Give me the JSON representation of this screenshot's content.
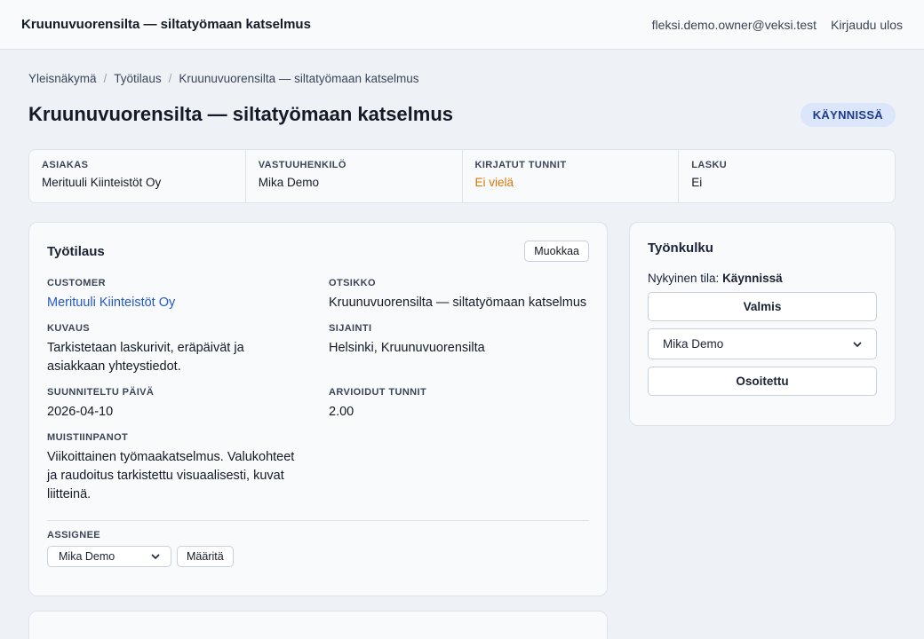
{
  "header": {
    "app_title": "Kruunuvuorensilta — siltatyömaan katselmus",
    "user_email": "fleksi.demo.owner@veksi.test",
    "logout_label": "Kirjaudu ulos"
  },
  "breadcrumb": {
    "items": [
      "Yleisnäkymä",
      "Työtilaus",
      "Kruunuvuorensilta — siltatyömaan katselmus"
    ],
    "separator": "/"
  },
  "page": {
    "title": "Kruunuvuorensilta — siltatyömaan katselmus",
    "status": "KÄYNNISSÄ"
  },
  "summary": [
    {
      "label": "ASIAKAS",
      "value": "Merituuli Kiinteistöt Oy"
    },
    {
      "label": "VASTUUHENKILÖ",
      "value": "Mika Demo"
    },
    {
      "label": "KIRJATUT TUNNIT",
      "value": "Ei vielä"
    },
    {
      "label": "LASKU",
      "value": "Ei"
    }
  ],
  "work_order": {
    "title": "Työtilaus",
    "edit_label": "Muokkaa",
    "customer_label": "CUSTOMER",
    "customer_value": "Merituuli Kiinteistöt Oy",
    "otsikko_label": "OTSIKKO",
    "otsikko_value": "Kruunuvuorensilta — siltatyömaan katselmus",
    "kuvaus_label": "KUVAUS",
    "kuvaus_value": "Tarkistetaan laskurivit, eräpäivät ja asiakkaan yhteystiedot.",
    "sijainti_label": "SIJAINTI",
    "sijainti_value": "Helsinki, Kruunuvuorensilta",
    "date_label": "SUUNNITELTU PÄIVÄ",
    "date_value": "2026-04-10",
    "hours_label": "ARVIOIDUT TUNNIT",
    "hours_value": "2.00",
    "notes_label": "MUISTIINPANOT",
    "notes_value": "Viikoittainen työmaakatselmus. Valukohteet ja raudoitus tarkistettu visuaalisesti, kuvat liitteinä.",
    "assignee_label": "ASSIGNEE",
    "assignee_selected": "Mika Demo",
    "assign_button": "Määritä"
  },
  "workflow": {
    "title": "Työnkulku",
    "current_label": "Nykyinen tila:",
    "current_value": "Käynnissä",
    "done_button": "Valmis",
    "person_selected": "Mika Demo",
    "assigned_button": "Osoitettu"
  },
  "colors": {
    "accent": "#2458c8",
    "warning": "#d97706",
    "badge_bg": "#dbe6fb",
    "badge_text": "#1e3a8a"
  }
}
